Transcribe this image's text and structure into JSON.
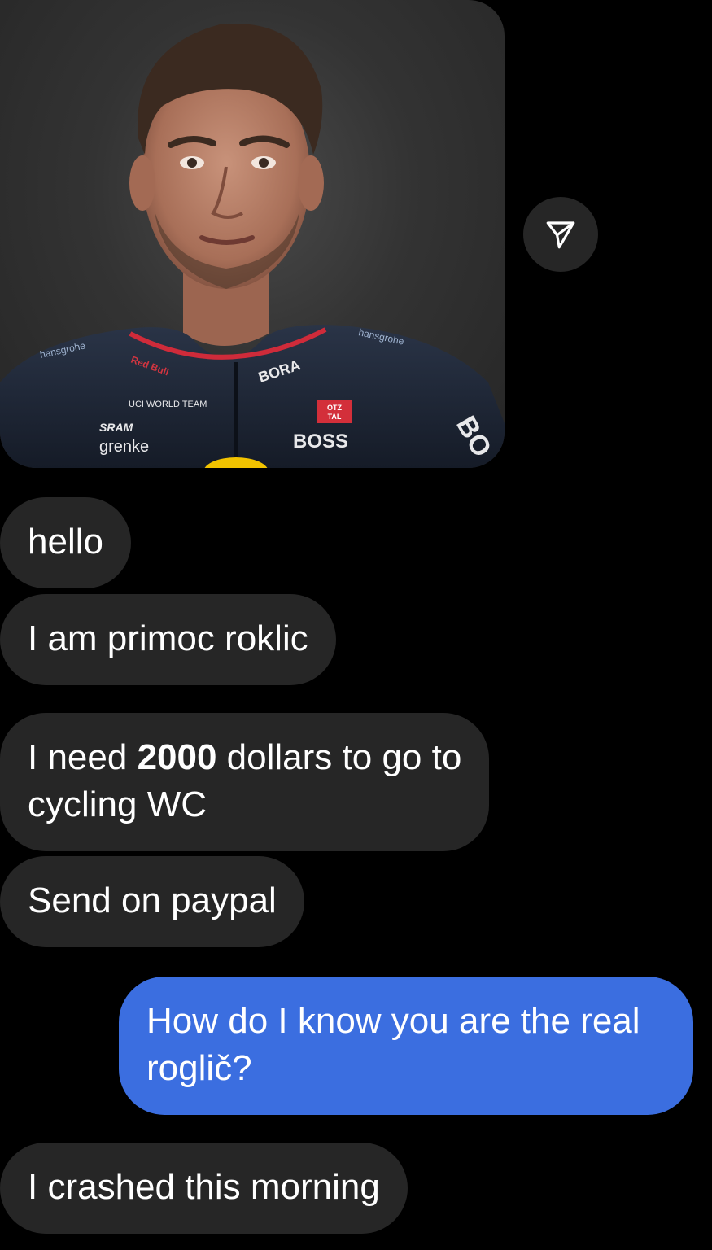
{
  "photo": {
    "jersey_texts": [
      "BORA",
      "hansgrohe",
      "UCI WORLD TEAM",
      "SRAM",
      "grenke",
      "ÖTZ TAL",
      "BOSS",
      "BO",
      "Red Bull"
    ]
  },
  "share_button": {
    "icon": "send-icon"
  },
  "messages": {
    "m1": "hello",
    "m2": "I am primoc roklic",
    "m3_pre": "I need ",
    "m3_bold": "2000",
    "m3_post": " dollars to go to",
    "m3_line2": "cycling WC",
    "m4": "Send on paypal",
    "m5_line1": "How do I know you are the real",
    "m5_line2": "roglič?",
    "m6": "I crashed this morning"
  },
  "colors": {
    "background": "#000000",
    "incoming_bubble": "#262626",
    "outgoing_bubble": "#3b6ee0"
  }
}
